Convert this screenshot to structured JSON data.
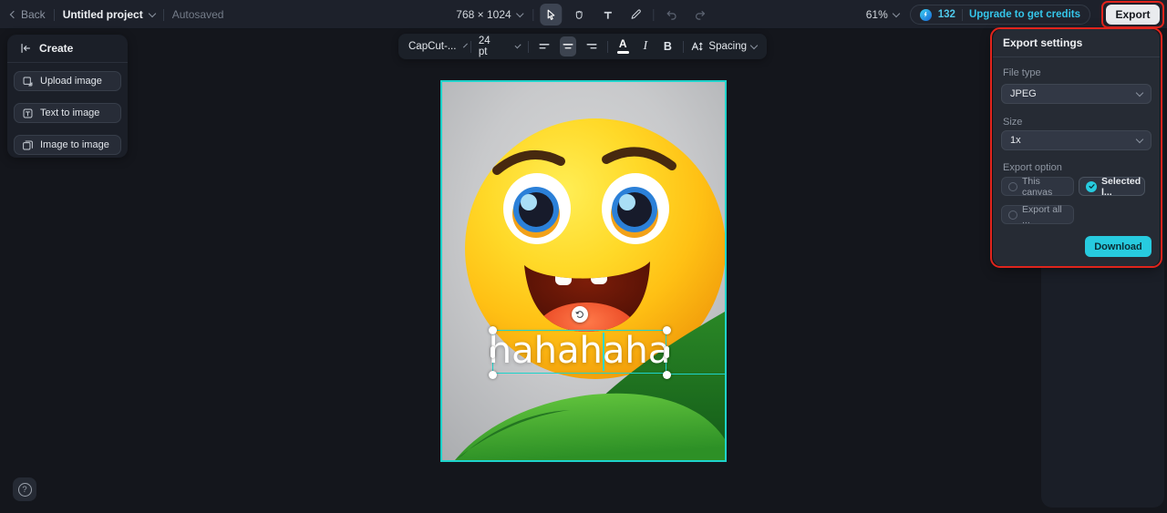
{
  "topbar": {
    "back_label": "Back",
    "project_name": "Untitled project",
    "autosaved": "Autosaved",
    "canvas_size": "768 × 1024",
    "zoom_level": "61%",
    "credits": "132",
    "upgrade_label": "Upgrade to get credits",
    "export_label": "Export"
  },
  "text_toolbar": {
    "font_name": "CapCut-...",
    "font_size": "24 pt",
    "color_letter": "A",
    "italic_letter": "I",
    "bold_letter": "B",
    "spacing_label": "Spacing"
  },
  "sidebar": {
    "title": "Create",
    "items": [
      {
        "label": "Upload image",
        "icon": "upload-image-icon"
      },
      {
        "label": "Text to image",
        "icon": "text-to-image-icon"
      },
      {
        "label": "Image to image",
        "icon": "image-to-image-icon"
      }
    ]
  },
  "canvas": {
    "text_value": "hahahaha"
  },
  "export_panel": {
    "title": "Export settings",
    "file_type_label": "File type",
    "file_type_value": "JPEG",
    "size_label": "Size",
    "size_value": "1x",
    "option_label": "Export option",
    "options": [
      {
        "label": "This canvas",
        "selected": false
      },
      {
        "label": "Selected l...",
        "selected": true
      },
      {
        "label": "Export all ...",
        "selected": false
      }
    ],
    "download_label": "Download"
  },
  "help": {
    "glyph": "?"
  },
  "colors": {
    "accent_cyan": "#27cbdf",
    "selection_teal": "#1ed3cb",
    "annotation_red": "#e0241c",
    "topbar_bg": "#1d212b",
    "panel_bg": "#1b1f28"
  }
}
